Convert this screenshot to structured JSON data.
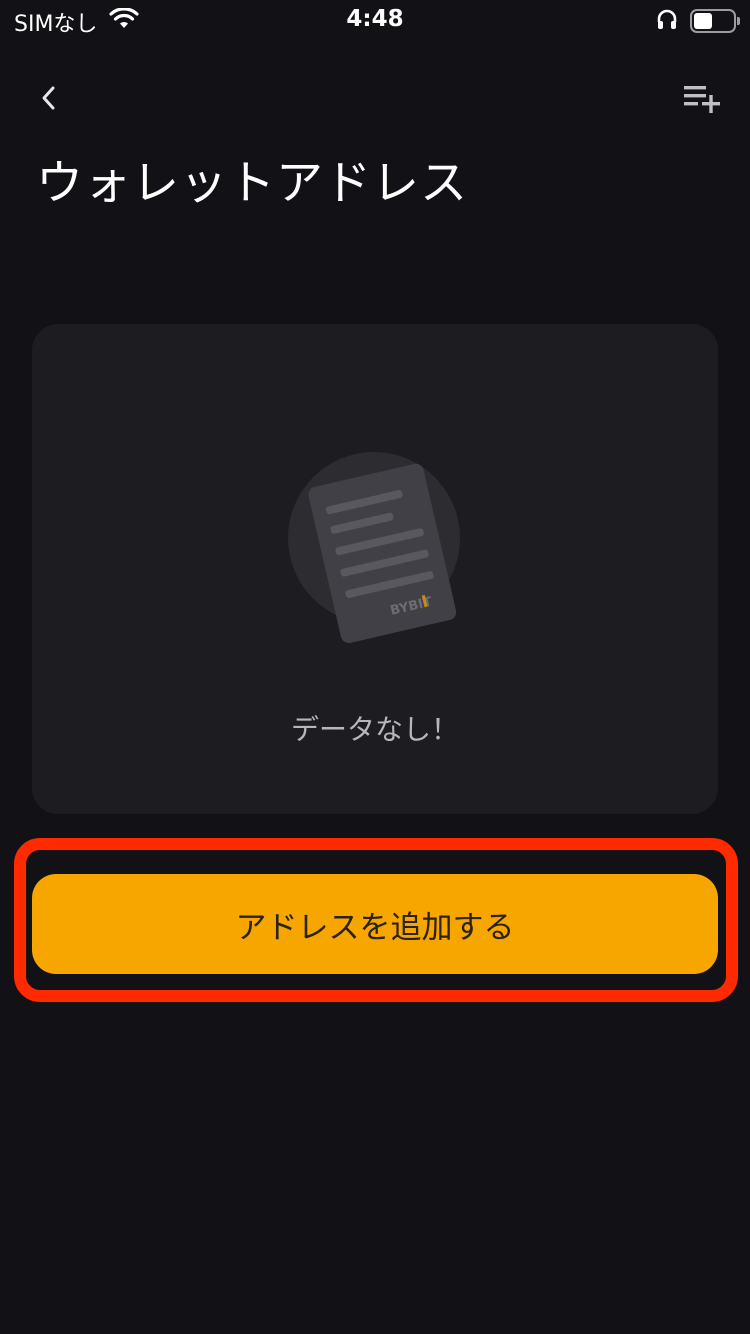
{
  "status_bar": {
    "carrier": "SIMなし",
    "time": "4:48"
  },
  "nav": {
    "back_icon": "chevron-left-icon",
    "action_icon": "playlist-add-icon"
  },
  "page": {
    "title": "ウォレットアドレス"
  },
  "empty_state": {
    "message": "データなし！",
    "logo_text": "BYBIT"
  },
  "actions": {
    "add_address_label": "アドレスを追加する"
  },
  "colors": {
    "background": "#111116",
    "card": "#1c1c21",
    "accent": "#f7a600",
    "highlight": "#ff2a00"
  }
}
